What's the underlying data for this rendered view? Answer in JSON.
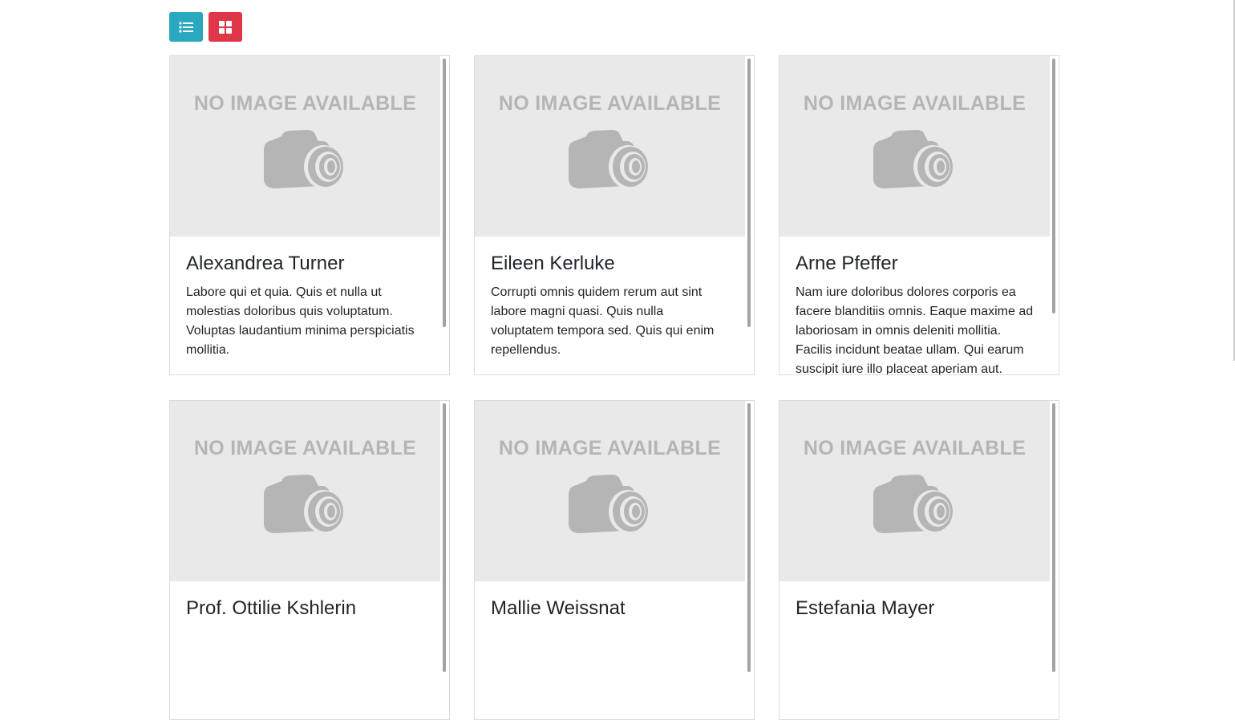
{
  "toolbar": {
    "list_view_icon": "list-icon",
    "grid_view_icon": "grid-icon",
    "colors": {
      "list": "#2aa8bf",
      "grid": "#e0364a"
    }
  },
  "placeholder": {
    "text": "NO IMAGE AVAILABLE",
    "icon": "camera-icon"
  },
  "cards": [
    {
      "name": "Alexandrea Turner",
      "description": "Labore qui et quia. Quis et nulla ut molestias doloribus quis voluptatum. Voluptas laudantium minima perspiciatis mollitia."
    },
    {
      "name": "Eileen Kerluke",
      "description": "Corrupti omnis quidem rerum aut sint labore magni quasi. Quis nulla voluptatem tempora sed. Quis qui enim repellendus."
    },
    {
      "name": "Arne Pfeffer",
      "description": "Nam iure doloribus dolores corporis ea facere blanditiis omnis. Eaque maxime ad laboriosam in omnis deleniti mollitia. Facilis incidunt beatae ullam. Qui earum suscipit iure illo placeat aperiam aut."
    },
    {
      "name": "Prof. Ottilie Kshlerin",
      "description": ""
    },
    {
      "name": "Mallie Weissnat",
      "description": ""
    },
    {
      "name": "Estefania Mayer",
      "description": ""
    }
  ]
}
